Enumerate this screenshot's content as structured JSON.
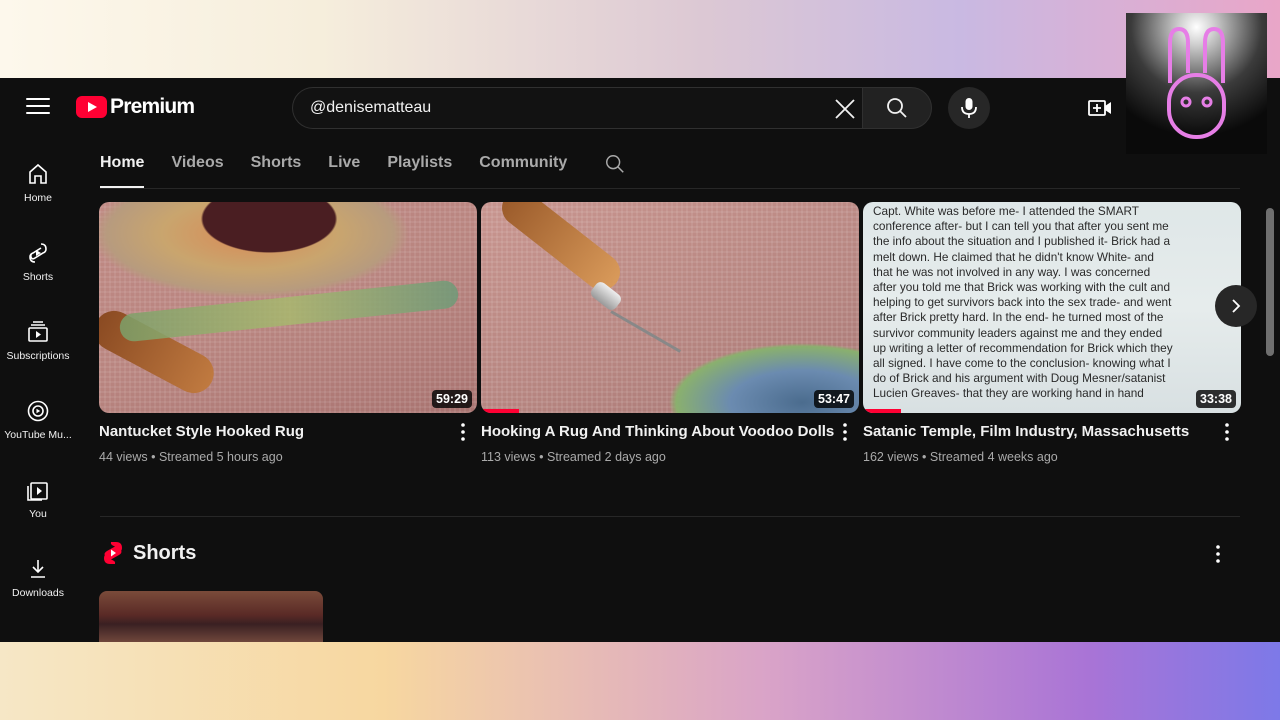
{
  "header": {
    "logo_text": "Premium",
    "search_value": "@denisematteau"
  },
  "sidebar": {
    "items": [
      {
        "label": "Home",
        "icon": "home-icon"
      },
      {
        "label": "Shorts",
        "icon": "shorts-icon"
      },
      {
        "label": "Subscriptions",
        "icon": "subscriptions-icon"
      },
      {
        "label": "YouTube Mu...",
        "icon": "youtube-music-icon"
      },
      {
        "label": "You",
        "icon": "you-icon"
      },
      {
        "label": "Downloads",
        "icon": "download-icon"
      }
    ]
  },
  "tabs": [
    {
      "label": "Home",
      "active": true
    },
    {
      "label": "Videos",
      "active": false
    },
    {
      "label": "Shorts",
      "active": false
    },
    {
      "label": "Live",
      "active": false
    },
    {
      "label": "Playlists",
      "active": false
    },
    {
      "label": "Community",
      "active": false
    }
  ],
  "videos": [
    {
      "title": "Nantucket Style Hooked Rug",
      "meta": "44 views • Streamed 5 hours ago",
      "duration": "59:29",
      "progress": 0
    },
    {
      "title": "Hooking A Rug And Thinking About Voodoo Dolls",
      "meta": "113 views • Streamed 2 days ago",
      "duration": "53:47",
      "progress": 0.1
    },
    {
      "title": "Satanic Temple, Film Industry, Massachusetts",
      "meta": "162 views • Streamed 4 weeks ago",
      "duration": "33:38",
      "progress": 0.1,
      "thumb_text": [
        "Capt. White was before me- I attended the SMART",
        "conference after- but I can tell you that after you sent me",
        "the info about the situation and I published it- Brick had a",
        "melt down.  He claimed that he didn't know White- and",
        "that he was not involved in any way.  I was concerned",
        "after you told me that Brick was working with the cult and",
        "helping to get survivors back into the sex trade- and went",
        "after Brick pretty hard.  In the end- he turned most of the",
        "survivor community leaders against me and they ended",
        "up writing a letter of recommendation for Brick which they",
        "all signed.  I have come to the conclusion- knowing what I",
        "do of Brick and his argument with Doug Mesner/satanist",
        "Lucien Greaves- that they are working hand in hand"
      ]
    }
  ],
  "shorts_section": {
    "title": "Shorts"
  },
  "colors": {
    "background": "#0f0f0f",
    "accent": "#ff0033",
    "text_secondary": "#aaaaaa"
  }
}
